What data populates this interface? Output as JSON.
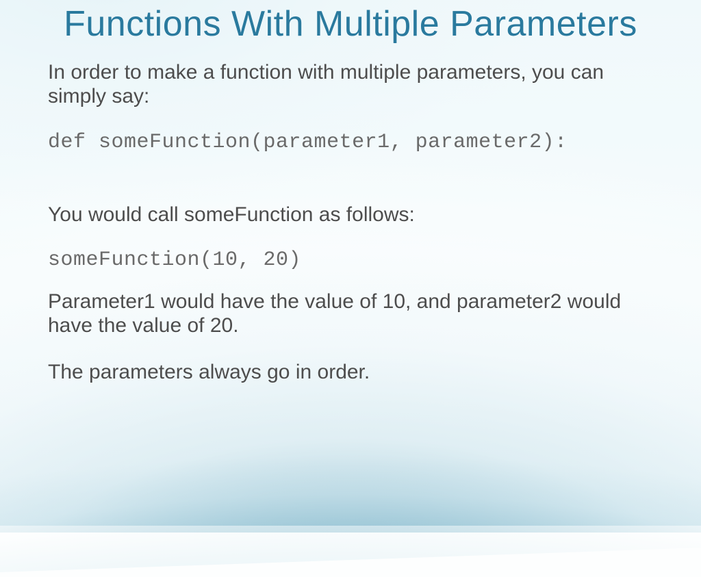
{
  "title": "Functions With Multiple Parameters",
  "body": {
    "intro": "In order to make a function with multiple parameters, you can simply say:",
    "code_def": "def someFunction(parameter1, parameter2):",
    "call_intro": "You would call someFunction as follows:",
    "code_call": "someFunction(10, 20)",
    "explain": "Parameter1 would have the value of 10, and parameter2 would have the value of 20.",
    "order_note": "The parameters always go in order."
  }
}
